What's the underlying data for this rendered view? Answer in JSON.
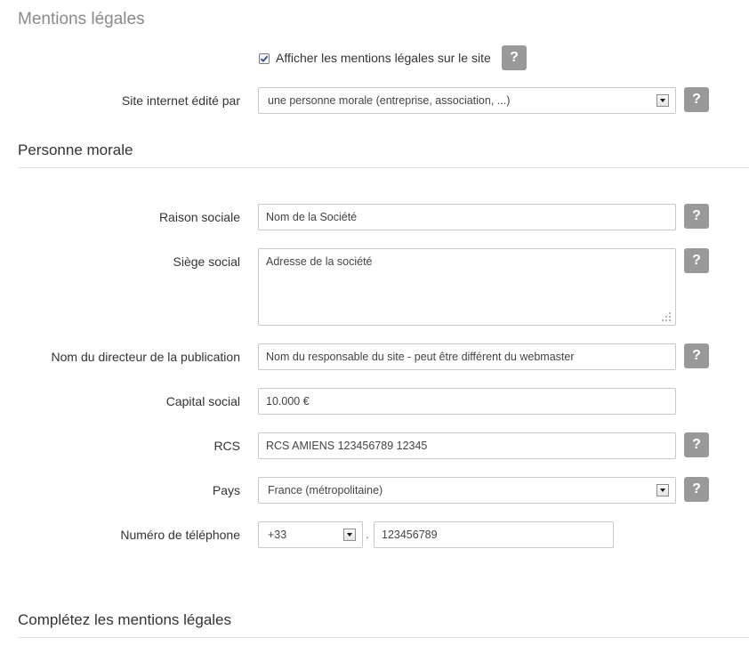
{
  "page_title": "Mentions légales",
  "show_legal": {
    "checked": true,
    "label": "Afficher les mentions légales sur le site",
    "help": "?"
  },
  "edited_by": {
    "label": "Site internet édité par",
    "value": "une personne morale (entreprise, association, ...)",
    "help": "?"
  },
  "section_company": {
    "title": "Personne morale",
    "fields": {
      "raison_sociale": {
        "label": "Raison sociale",
        "placeholder": "Nom de la Société",
        "help": "?"
      },
      "siege_social": {
        "label": "Siège social",
        "placeholder": "Adresse de la société",
        "help": "?"
      },
      "directeur": {
        "label": "Nom du directeur de la publication",
        "placeholder": "Nom du responsable du site - peut être différent du webmaster",
        "help": "?"
      },
      "capital": {
        "label": "Capital social",
        "value": "10.000 €"
      },
      "rcs": {
        "label": "RCS",
        "value": "RCS AMIENS 123456789 12345",
        "help": "?"
      },
      "pays": {
        "label": "Pays",
        "value": "France (métropolitaine)",
        "help": "?"
      },
      "telephone": {
        "label": "Numéro de téléphone",
        "country_code": "+33",
        "separator": ".",
        "number": "123456789"
      }
    }
  },
  "section_complete": {
    "title": "Complétez les mentions légales"
  },
  "colors": {
    "help_button": "#999999",
    "title_gray": "#8a8a8a",
    "divider": "#e4e4e4"
  }
}
